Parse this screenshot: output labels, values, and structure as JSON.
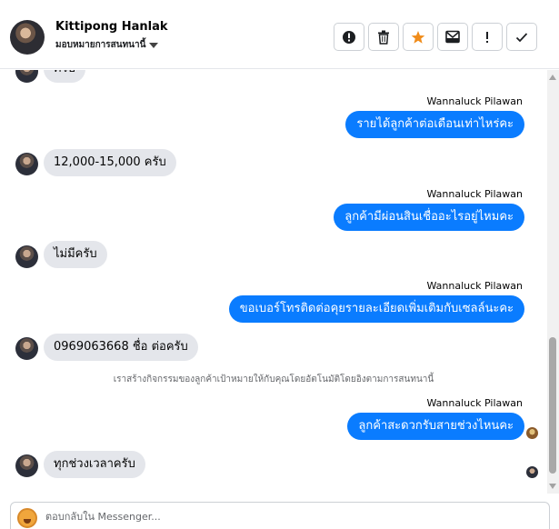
{
  "header": {
    "contact_name": "Kittipong Hanlak",
    "subtitle": "มอบหมายการสนทนานี้"
  },
  "actions": [
    {
      "name": "report-spam-button",
      "icon": "alert-circle-icon"
    },
    {
      "name": "delete-button",
      "icon": "trash-icon"
    },
    {
      "name": "star-button",
      "icon": "star-icon",
      "color": "#f08c1a"
    },
    {
      "name": "mark-unread-button",
      "icon": "envelope-icon"
    },
    {
      "name": "follow-up-button",
      "icon": "exclamation-icon"
    },
    {
      "name": "mark-done-button",
      "icon": "check-icon"
    }
  ],
  "messages": [
    {
      "side": "in",
      "text": "ครับ"
    },
    {
      "side": "out",
      "sender": "Wannaluck Pilawan",
      "text": "รายได้ลูกค้าต่อเดือนเท่าไหร่คะ"
    },
    {
      "side": "in",
      "text": "12,000-15,000 ครับ"
    },
    {
      "side": "out",
      "sender": "Wannaluck Pilawan",
      "text": "ลูกค้ามีผ่อนสินเชื่ออะไรอยู่ไหมคะ"
    },
    {
      "side": "in",
      "text": "ไม่มีครับ"
    },
    {
      "side": "out",
      "sender": "Wannaluck Pilawan",
      "text": "ขอเบอร์โทรติดต่อคุยรายละเอียดเพิ่มเติมกับเซลล์นะคะ"
    },
    {
      "side": "in",
      "text": "0969063668 ชื่อ ต่อครับ"
    },
    {
      "side": "note",
      "text": "เราสร้างกิจกรรมของลูกค้าเป้าหมายให้กับคุณโดยอัตโนมัติโดยอิงตามการสนทนานี้"
    },
    {
      "side": "out",
      "sender": "Wannaluck Pilawan",
      "text": "ลูกค้าสะดวกรับสายช่วงไหนคะ"
    },
    {
      "side": "in",
      "text": "ทุกช่วงเวลาครับ"
    }
  ],
  "composer": {
    "placeholder": "ตอบกลับใน Messenger..."
  },
  "colors": {
    "outgoing_bubble": "#0a7cff",
    "incoming_bubble": "#e4e6eb",
    "star": "#f08c1a"
  }
}
